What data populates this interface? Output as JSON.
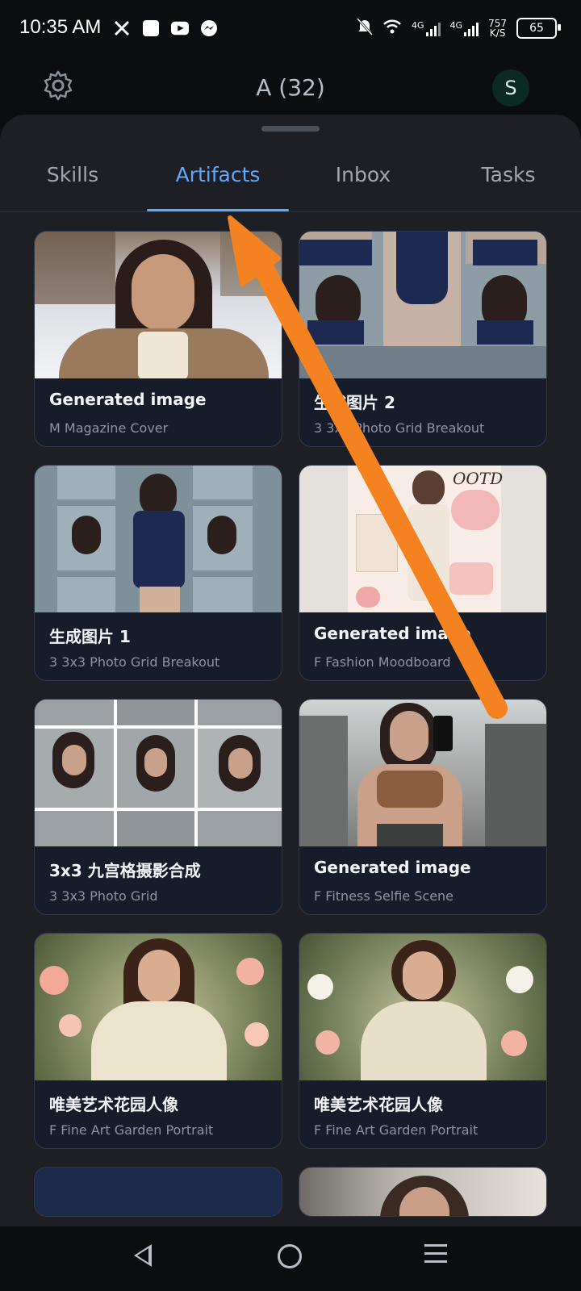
{
  "status_bar": {
    "time": "10:35 AM",
    "net_speed_top": "757",
    "net_speed_bottom": "K/S",
    "battery": "65",
    "signal_label_1": "4G",
    "signal_label_2": "4G"
  },
  "header": {
    "title": "A (32)",
    "avatar_letter": "S"
  },
  "tabs": [
    {
      "label": "Skills"
    },
    {
      "label": "Artifacts",
      "active": true
    },
    {
      "label": "Inbox"
    },
    {
      "label": "Tasks"
    }
  ],
  "cards": [
    {
      "title": "Generated image",
      "subtitle": "M Magazine Cover"
    },
    {
      "title": "生成图片 2",
      "subtitle": "3 3x3 Photo Grid Breakout"
    },
    {
      "title": "生成图片 1",
      "subtitle": "3 3x3 Photo Grid Breakout"
    },
    {
      "title": "Generated image",
      "subtitle": "F Fashion Moodboard"
    },
    {
      "title": "3x3 九宫格摄影合成",
      "subtitle": "3 3x3 Photo Grid"
    },
    {
      "title": "Generated image",
      "subtitle": "F Fitness Selfie Scene"
    },
    {
      "title": "唯美艺术花园人像",
      "subtitle": "F Fine Art Garden Portrait"
    },
    {
      "title": "唯美艺术花园人像",
      "subtitle": "F Fine Art Garden Portrait"
    }
  ],
  "colors": {
    "accent": "#5fa8ff",
    "arrow": "#f58220",
    "sheet": "#1d1f24",
    "card": "#171c2a"
  }
}
